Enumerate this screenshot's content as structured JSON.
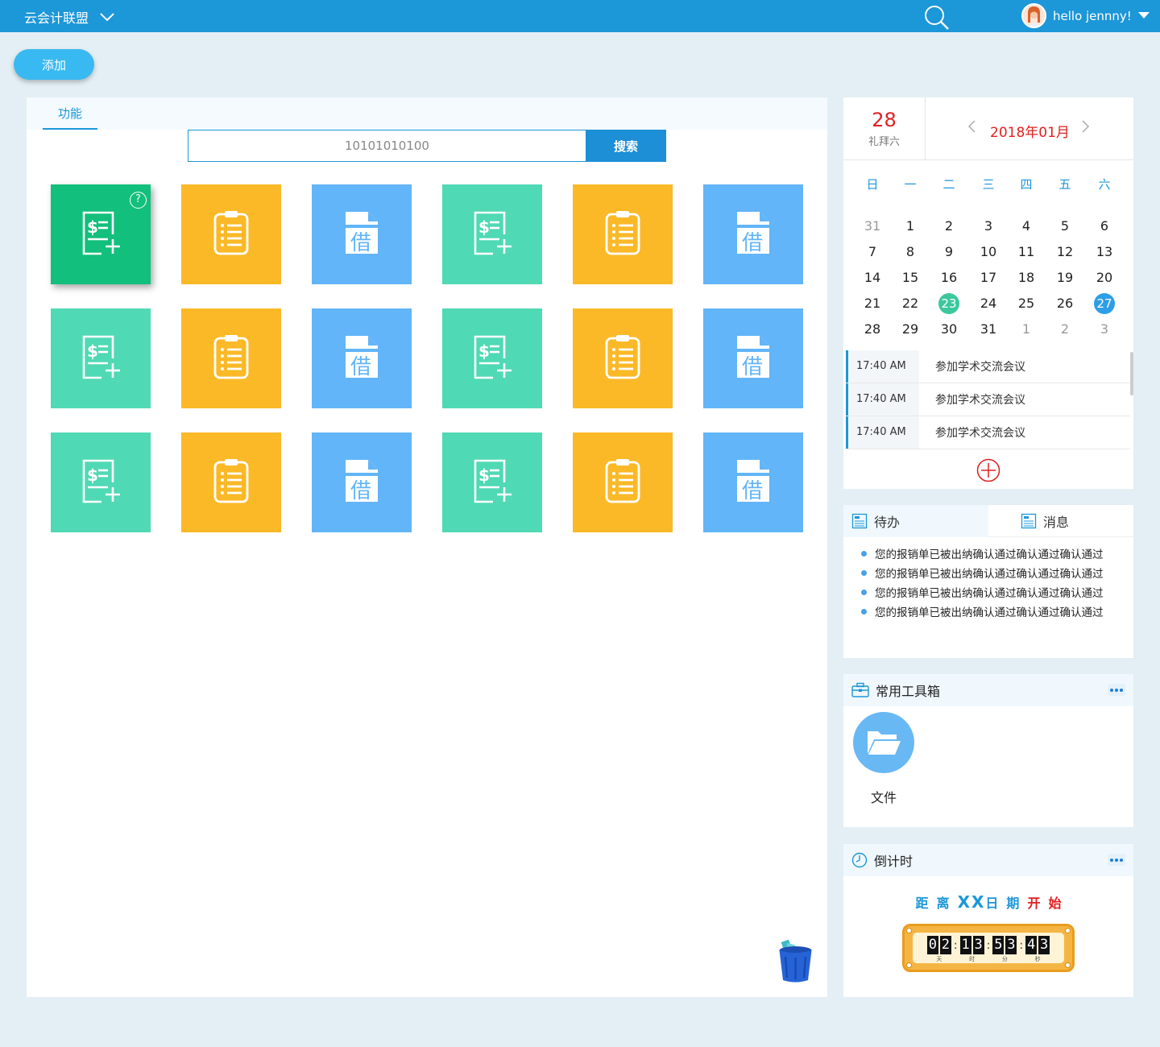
{
  "topbar": {
    "brand": "云会计联盟",
    "user_greeting": "hello jennny!"
  },
  "toolbar": {
    "add_label": "添加"
  },
  "main": {
    "tab_label": "功能",
    "search": {
      "value": "10101010100",
      "button_label": "搜索"
    },
    "tiles": [
      {
        "type": "reimburse",
        "color": "green",
        "active": true
      },
      {
        "type": "clipboard",
        "color": "yellow"
      },
      {
        "type": "borrow",
        "color": "blue"
      },
      {
        "type": "reimburse",
        "color": "green"
      },
      {
        "type": "clipboard",
        "color": "yellow"
      },
      {
        "type": "borrow",
        "color": "blue"
      },
      {
        "type": "reimburse",
        "color": "green"
      },
      {
        "type": "clipboard",
        "color": "yellow"
      },
      {
        "type": "borrow",
        "color": "blue"
      },
      {
        "type": "reimburse",
        "color": "green"
      },
      {
        "type": "clipboard",
        "color": "yellow"
      },
      {
        "type": "borrow",
        "color": "blue"
      },
      {
        "type": "reimburse",
        "color": "green"
      },
      {
        "type": "clipboard",
        "color": "yellow"
      },
      {
        "type": "borrow",
        "color": "blue"
      },
      {
        "type": "reimburse",
        "color": "green"
      },
      {
        "type": "clipboard",
        "color": "yellow"
      },
      {
        "type": "borrow",
        "color": "blue"
      }
    ],
    "borrow_char": "借",
    "help_char": "?"
  },
  "calendar": {
    "day": "28",
    "weekday": "礼拜六",
    "month_label": "2018年01月",
    "week_headers": [
      "日",
      "一",
      "二",
      "三",
      "四",
      "五",
      "六"
    ],
    "weeks": [
      [
        "31",
        "1",
        "2",
        "3",
        "4",
        "5",
        "6"
      ],
      [
        "7",
        "8",
        "9",
        "10",
        "11",
        "12",
        "13"
      ],
      [
        "14",
        "15",
        "16",
        "17",
        "18",
        "19",
        "20"
      ],
      [
        "21",
        "22",
        "23",
        "24",
        "25",
        "26",
        "27"
      ],
      [
        "28",
        "29",
        "30",
        "31",
        "1",
        "2",
        "3"
      ]
    ],
    "today": "23",
    "selected": "27",
    "events": [
      {
        "time": "17:40  AM",
        "title": "参加学术交流会议"
      },
      {
        "time": "17:40  AM",
        "title": "参加学术交流会议"
      },
      {
        "time": "17:40  AM",
        "title": "参加学术交流会议"
      }
    ]
  },
  "todo": {
    "tab_todo": "待办",
    "tab_messages": "消息",
    "items": [
      "您的报销单已被出纳确认通过确认通过确认通过",
      "您的报销单已被出纳确认通过确认通过确认通过",
      "您的报销单已被出纳确认通过确认通过确认通过",
      "您的报销单已被出纳确认通过确认通过确认通过"
    ]
  },
  "tools": {
    "title": "常用工具箱",
    "items": [
      {
        "label": "文件",
        "icon": "folder-icon"
      }
    ]
  },
  "countdown": {
    "title": "倒计时",
    "headline": [
      {
        "text": "距",
        "color": "#1c97d8"
      },
      {
        "text": "离",
        "color": "#1c97d8"
      },
      {
        "text": "X",
        "color": "#1c97d8"
      },
      {
        "text": "X",
        "color": "#1c97d8"
      },
      {
        "text": "日",
        "color": "#1c97d8"
      },
      {
        "text": "期",
        "color": "#1c97d8"
      },
      {
        "text": "开",
        "color": "#e02020"
      },
      {
        "text": "始",
        "color": "#e02020"
      }
    ],
    "values": [
      {
        "digits": "02",
        "unit": "天"
      },
      {
        "digits": "13",
        "unit": "时"
      },
      {
        "digits": "53",
        "unit": "分"
      },
      {
        "digits": "43",
        "unit": "秒"
      }
    ]
  }
}
